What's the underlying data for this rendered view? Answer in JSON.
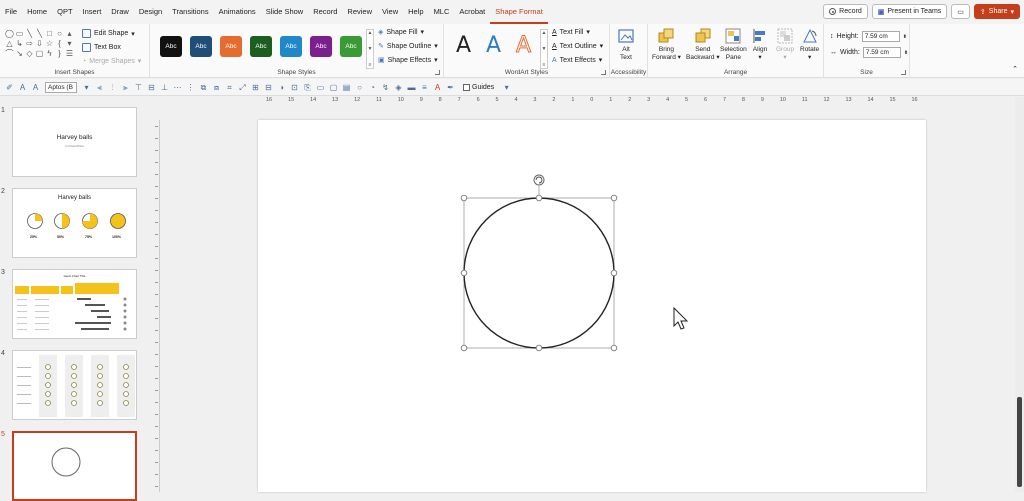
{
  "menu": {
    "tabs": [
      "File",
      "Home",
      "QPT",
      "Insert",
      "Draw",
      "Design",
      "Transitions",
      "Animations",
      "Slide Show",
      "Record",
      "Review",
      "View",
      "Help",
      "MLC",
      "Acrobat",
      "Shape Format"
    ],
    "active_tab": "Shape Format",
    "record_label": "Record",
    "present_label": "Present in Teams",
    "share_label": "Share"
  },
  "ribbon": {
    "insert_shapes": {
      "label": "Insert Shapes",
      "edit_shape": "Edit Shape",
      "text_box": "Text Box",
      "merge_shapes": "Merge Shapes"
    },
    "shape_styles": {
      "label": "Shape Styles",
      "swatch_text": "Abc",
      "swatch_colors": [
        "#111111",
        "#1f4e79",
        "#e56b2e",
        "#1b5e20",
        "#1e88c8",
        "#7b1f8c",
        "#3a9a33"
      ],
      "fill": "Shape Fill",
      "outline": "Shape Outline",
      "effects": "Shape Effects"
    },
    "wordart": {
      "label": "WordArt Styles",
      "letter": "A",
      "text_fill": "Text Fill",
      "text_outline": "Text Outline",
      "text_effects": "Text Effects"
    },
    "accessibility": {
      "label": "Accessibility",
      "alt_text_1": "Alt",
      "alt_text_2": "Text"
    },
    "arrange": {
      "label": "Arrange",
      "bring_forward_1": "Bring",
      "bring_forward_2": "Forward",
      "send_backward_1": "Send",
      "send_backward_2": "Backward",
      "selection_pane_1": "Selection",
      "selection_pane_2": "Pane",
      "align": "Align",
      "group": "Group",
      "rotate": "Rotate"
    },
    "size": {
      "label": "Size",
      "height_label": "Height:",
      "height_value": "7.59 cm",
      "width_label": "Width:",
      "width_value": "7.59 cm"
    }
  },
  "qat": {
    "font": "Aptos (B",
    "guides_label": "Guides"
  },
  "slides": [
    {
      "number": "1",
      "title": "Harvey balls",
      "subtitle": "In PowerPoint"
    },
    {
      "number": "2",
      "title": "Harvey balls",
      "labels": [
        "25%",
        "50%",
        "75%",
        "100%"
      ]
    },
    {
      "number": "3",
      "title": "Gantt Chart Title"
    },
    {
      "number": "4"
    },
    {
      "number": "5"
    }
  ],
  "ruler": {
    "ticks": [
      "16",
      "15",
      "14",
      "13",
      "12",
      "11",
      "10",
      "9",
      "8",
      "7",
      "6",
      "5",
      "4",
      "3",
      "2",
      "1",
      "0",
      "1",
      "2",
      "3",
      "4",
      "5",
      "6",
      "7",
      "8",
      "9",
      "10",
      "11",
      "12",
      "13",
      "14",
      "15",
      "16"
    ]
  },
  "colors": {
    "accent": "#c43e1c",
    "harvey_yellow": "#f4c21b",
    "selection_handle": "#777777"
  }
}
